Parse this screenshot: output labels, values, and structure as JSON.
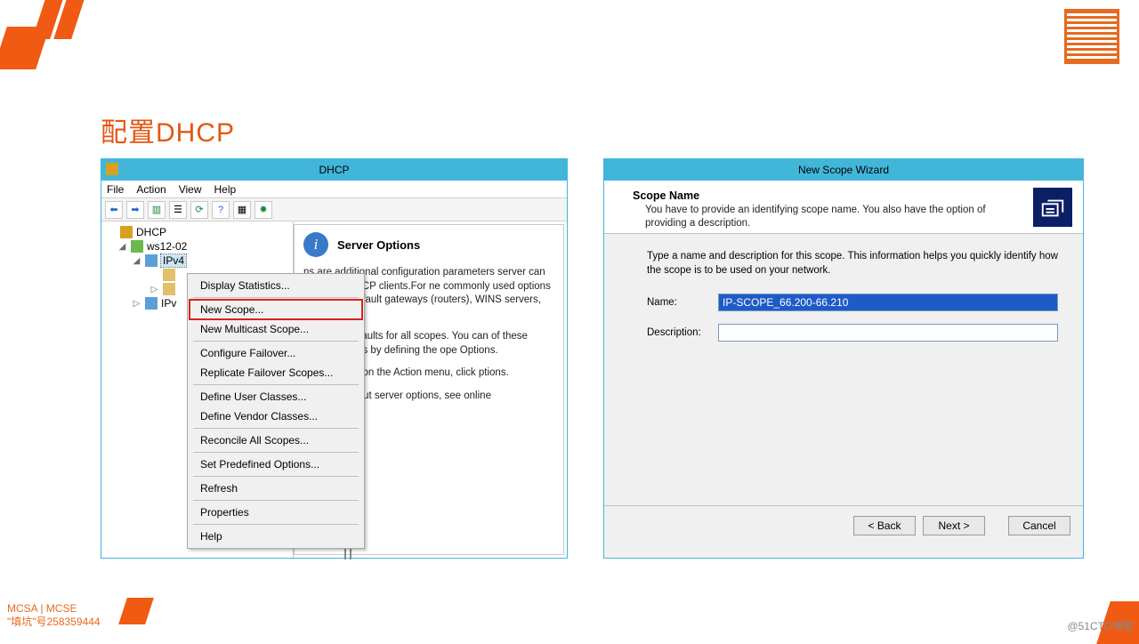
{
  "slide": {
    "title": "配置DHCP"
  },
  "footer": {
    "left1": "MCSA | MCSE",
    "left2": "\"填坑\"号258359444",
    "right": "@51CTO博客"
  },
  "dhcp": {
    "title": "DHCP",
    "menus": [
      "File",
      "Action",
      "View",
      "Help"
    ],
    "tree": {
      "root": "DHCP",
      "server": "ws12-02",
      "ipv4": "IPv4",
      "ipv4_children": [
        "",
        "",
        "IPv"
      ],
      "ipv6_short": "IPv"
    },
    "content": {
      "heading": "Server Options",
      "p1": "ns are additional configuration parameters server can assign to DHCP clients.For ne commonly used options include IP default gateways (routers), WINS servers, vers.",
      "p2": "ns act as defaults for all scopes.  You can of these server options by defining the ope Options.",
      "p3": "rver options, on the Action menu, click ptions.",
      "p4": "ormation about server options, see online"
    },
    "context_menu": [
      "Display Statistics...",
      "New Scope...",
      "New Multicast Scope...",
      "Configure Failover...",
      "Replicate Failover Scopes...",
      "Define User Classes...",
      "Define Vendor Classes...",
      "Reconcile All Scopes...",
      "Set Predefined Options...",
      "Refresh",
      "Properties",
      "Help"
    ]
  },
  "wizard": {
    "title": "New Scope Wizard",
    "header": "Scope Name",
    "header_sub": "You have to provide an identifying scope name. You also have the option of providing a description.",
    "intro": "Type a name and description for this scope. This information helps you quickly identify how the scope is to be used on your network.",
    "name_label": "Name:",
    "name_value": "IP-SCOPE_66.200-66.210",
    "desc_label": "Description:",
    "desc_value": "",
    "buttons": {
      "back": "< Back",
      "next": "Next >",
      "cancel": "Cancel"
    }
  }
}
